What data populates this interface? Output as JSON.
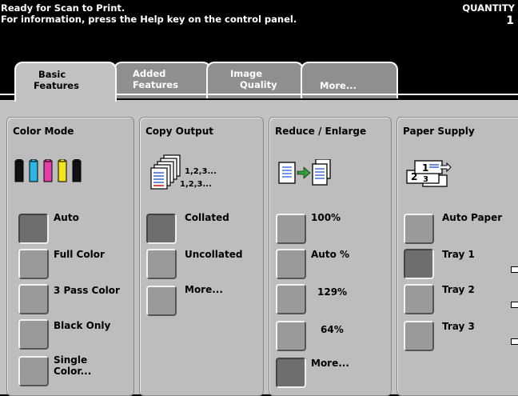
{
  "status": {
    "line1": "Ready for Scan to Print.",
    "line2": "For information, press the Help key on the control panel.",
    "quantity_label": "QUANTITY",
    "quantity_value": "1"
  },
  "tabs": [
    {
      "line1": "Basic",
      "line2": "Features",
      "active": true
    },
    {
      "line1": "Added",
      "line2": "Features",
      "active": false
    },
    {
      "line1": "Image",
      "line2": "Quality",
      "active": false
    },
    {
      "line1": "",
      "line2": "More...",
      "active": false
    }
  ],
  "panels": {
    "color_mode": {
      "title": "Color Mode",
      "icon": "toner-bottles-icon",
      "options": [
        "Auto",
        "Full Color",
        "3 Pass Color",
        "Black Only",
        "Single Color..."
      ],
      "single_line1": "Single",
      "single_line2": "Color...",
      "selected": "Auto"
    },
    "copy_output": {
      "title": "Copy Output",
      "icon": "collated-copies-icon",
      "icon_text1": "1,2,3...",
      "icon_text2": "1,2,3...",
      "options": [
        "Collated",
        "Uncollated",
        "More..."
      ],
      "selected": "Collated"
    },
    "reduce_enlarge": {
      "title": "Reduce / Enlarge",
      "icon": "reduce-enlarge-icon",
      "options": [
        "100%",
        "Auto %",
        "129%",
        "64%",
        "More..."
      ],
      "selected": "More..."
    },
    "paper_supply": {
      "title": "Paper Supply",
      "icon": "paper-trays-icon",
      "icon_text1": "1",
      "icon_text2": "2",
      "icon_text3": "3",
      "options": [
        "Auto Paper",
        "Tray 1",
        "Tray 2",
        "Tray 3"
      ],
      "selected": "Tray 1"
    }
  }
}
